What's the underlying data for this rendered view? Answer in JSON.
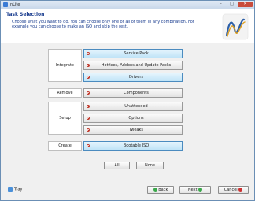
{
  "window": {
    "title": "nLite",
    "minimize": "–",
    "maximize": "□",
    "close": "✕"
  },
  "header": {
    "title": "Task Selection",
    "description": "Choose what you want to do. You can choose only one or all of them in any combination. For example you can choose to make an ISO and skip the rest."
  },
  "categories": [
    {
      "label": "Integrate"
    },
    {
      "label": "Remove"
    },
    {
      "label": "Setup"
    },
    {
      "label": "Create"
    }
  ],
  "tasks": [
    {
      "label": "Service Pack",
      "selected": true
    },
    {
      "label": "Hotfixes, Addons and Update Packs",
      "selected": false
    },
    {
      "label": "Drivers",
      "selected": true
    },
    {
      "label": "Components",
      "selected": false
    },
    {
      "label": "Unattended",
      "selected": false
    },
    {
      "label": "Options",
      "selected": false
    },
    {
      "label": "Tweaks",
      "selected": false
    },
    {
      "label": "Bootable ISO",
      "selected": true
    }
  ],
  "selection": {
    "all_label": "All",
    "none_label": "None"
  },
  "footer": {
    "tray_label": "Tray",
    "back_label": "Back",
    "next_label": "Next",
    "cancel_label": "Cancel"
  },
  "colors": {
    "header_text": "#1a3d8f",
    "selected_task": "#bfe3f7",
    "task_icon": "#c0392b"
  }
}
